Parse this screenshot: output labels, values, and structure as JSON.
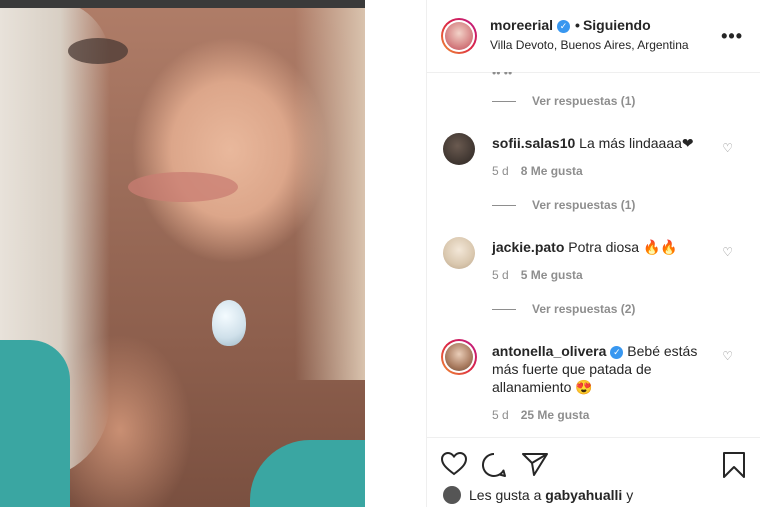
{
  "post": {
    "author": "moreerial",
    "separator": "•",
    "follow_status": "Siguiendo",
    "location": "Villa Devoto, Buenos Aires, Argentina",
    "more_label": "•••"
  },
  "comments": [
    {
      "type": "replies",
      "label": "Ver respuestas (1)"
    },
    {
      "type": "comment",
      "username": "sofii.salas10",
      "text": "La más lindaaaa❤",
      "age": "5 d",
      "likes": "8 Me gusta"
    },
    {
      "type": "replies",
      "label": "Ver respuestas (1)"
    },
    {
      "type": "comment",
      "username": "jackie.pato",
      "text": "Potra diosa 🔥🔥",
      "age": "5 d",
      "likes": "5 Me gusta"
    },
    {
      "type": "replies",
      "label": "Ver respuestas (2)"
    },
    {
      "type": "comment",
      "username": "antonella_olivera",
      "verified": true,
      "text": "Bebé estás más fuerte que patada de allanamiento 😍",
      "age": "5 d",
      "likes": "25 Me gusta"
    }
  ],
  "actions": {
    "like_icon": "heart-icon",
    "comment_icon": "comment-icon",
    "share_icon": "paper-plane-icon",
    "save_icon": "bookmark-icon"
  },
  "liked_by": {
    "prefix": "Les gusta a",
    "user": "gabyahualli",
    "suffix": "y"
  },
  "colors": {
    "link": "#262626",
    "muted": "#8e8e8e",
    "verified": "#3897f0",
    "divider": "#efefef"
  }
}
